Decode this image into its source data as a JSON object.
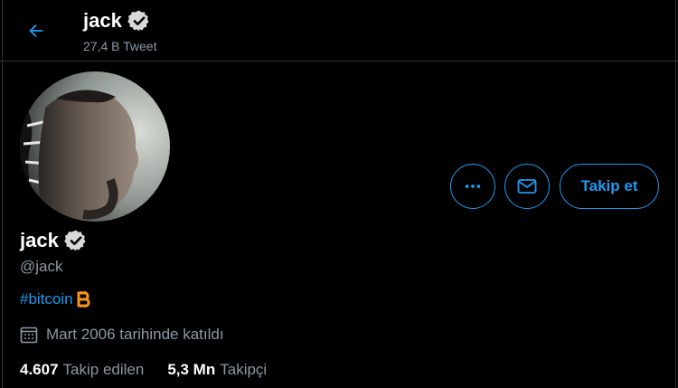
{
  "colors": {
    "accent": "#1d9bf0",
    "background": "#000000",
    "muted": "#8b98a5",
    "bitcoin": "#f7931a"
  },
  "header": {
    "back_icon": "arrow-left-icon",
    "name": "jack",
    "tweet_count": "27,4 B Tweet"
  },
  "profile": {
    "display_name": "jack",
    "handle": "@jack",
    "bio_hashtag": "#bitcoin",
    "bio_emoji_icon": "bitcoin-icon",
    "joined": "Mart 2006 tarihinde katıldı"
  },
  "actions": {
    "more_icon": "more-icon",
    "message_icon": "mail-icon",
    "follow_label": "Takip et"
  },
  "stats": {
    "following_count": "4.607",
    "following_label": "Takip edilen",
    "followers_count": "5,3 Mn",
    "followers_label": "Takipçi"
  }
}
